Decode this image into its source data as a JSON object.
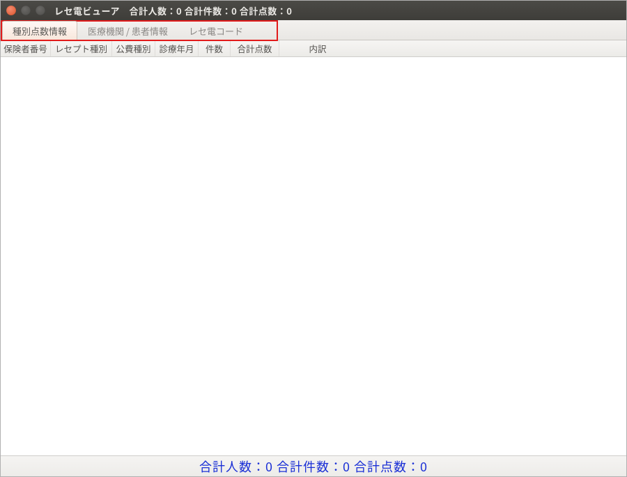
{
  "titlebar": {
    "title": "レセ電ビューア　合計人数：0 合計件数：0 合計点数：0"
  },
  "tabs": {
    "items": [
      {
        "label": "種別点数情報",
        "active": true
      },
      {
        "label": "医療機関 / 患者情報",
        "active": false
      },
      {
        "label": "レセ電コード",
        "active": false
      }
    ]
  },
  "table": {
    "columns": [
      "保険者番号",
      "レセプト種別",
      "公費種別",
      "診療年月",
      "件数",
      "合計点数",
      "内訳"
    ],
    "rows": []
  },
  "footer": {
    "summary": "合計人数：0 合計件数：0 合計点数：0"
  },
  "colors": {
    "annotation_red": "#e21a1a",
    "footer_text": "#1a2fd6"
  }
}
